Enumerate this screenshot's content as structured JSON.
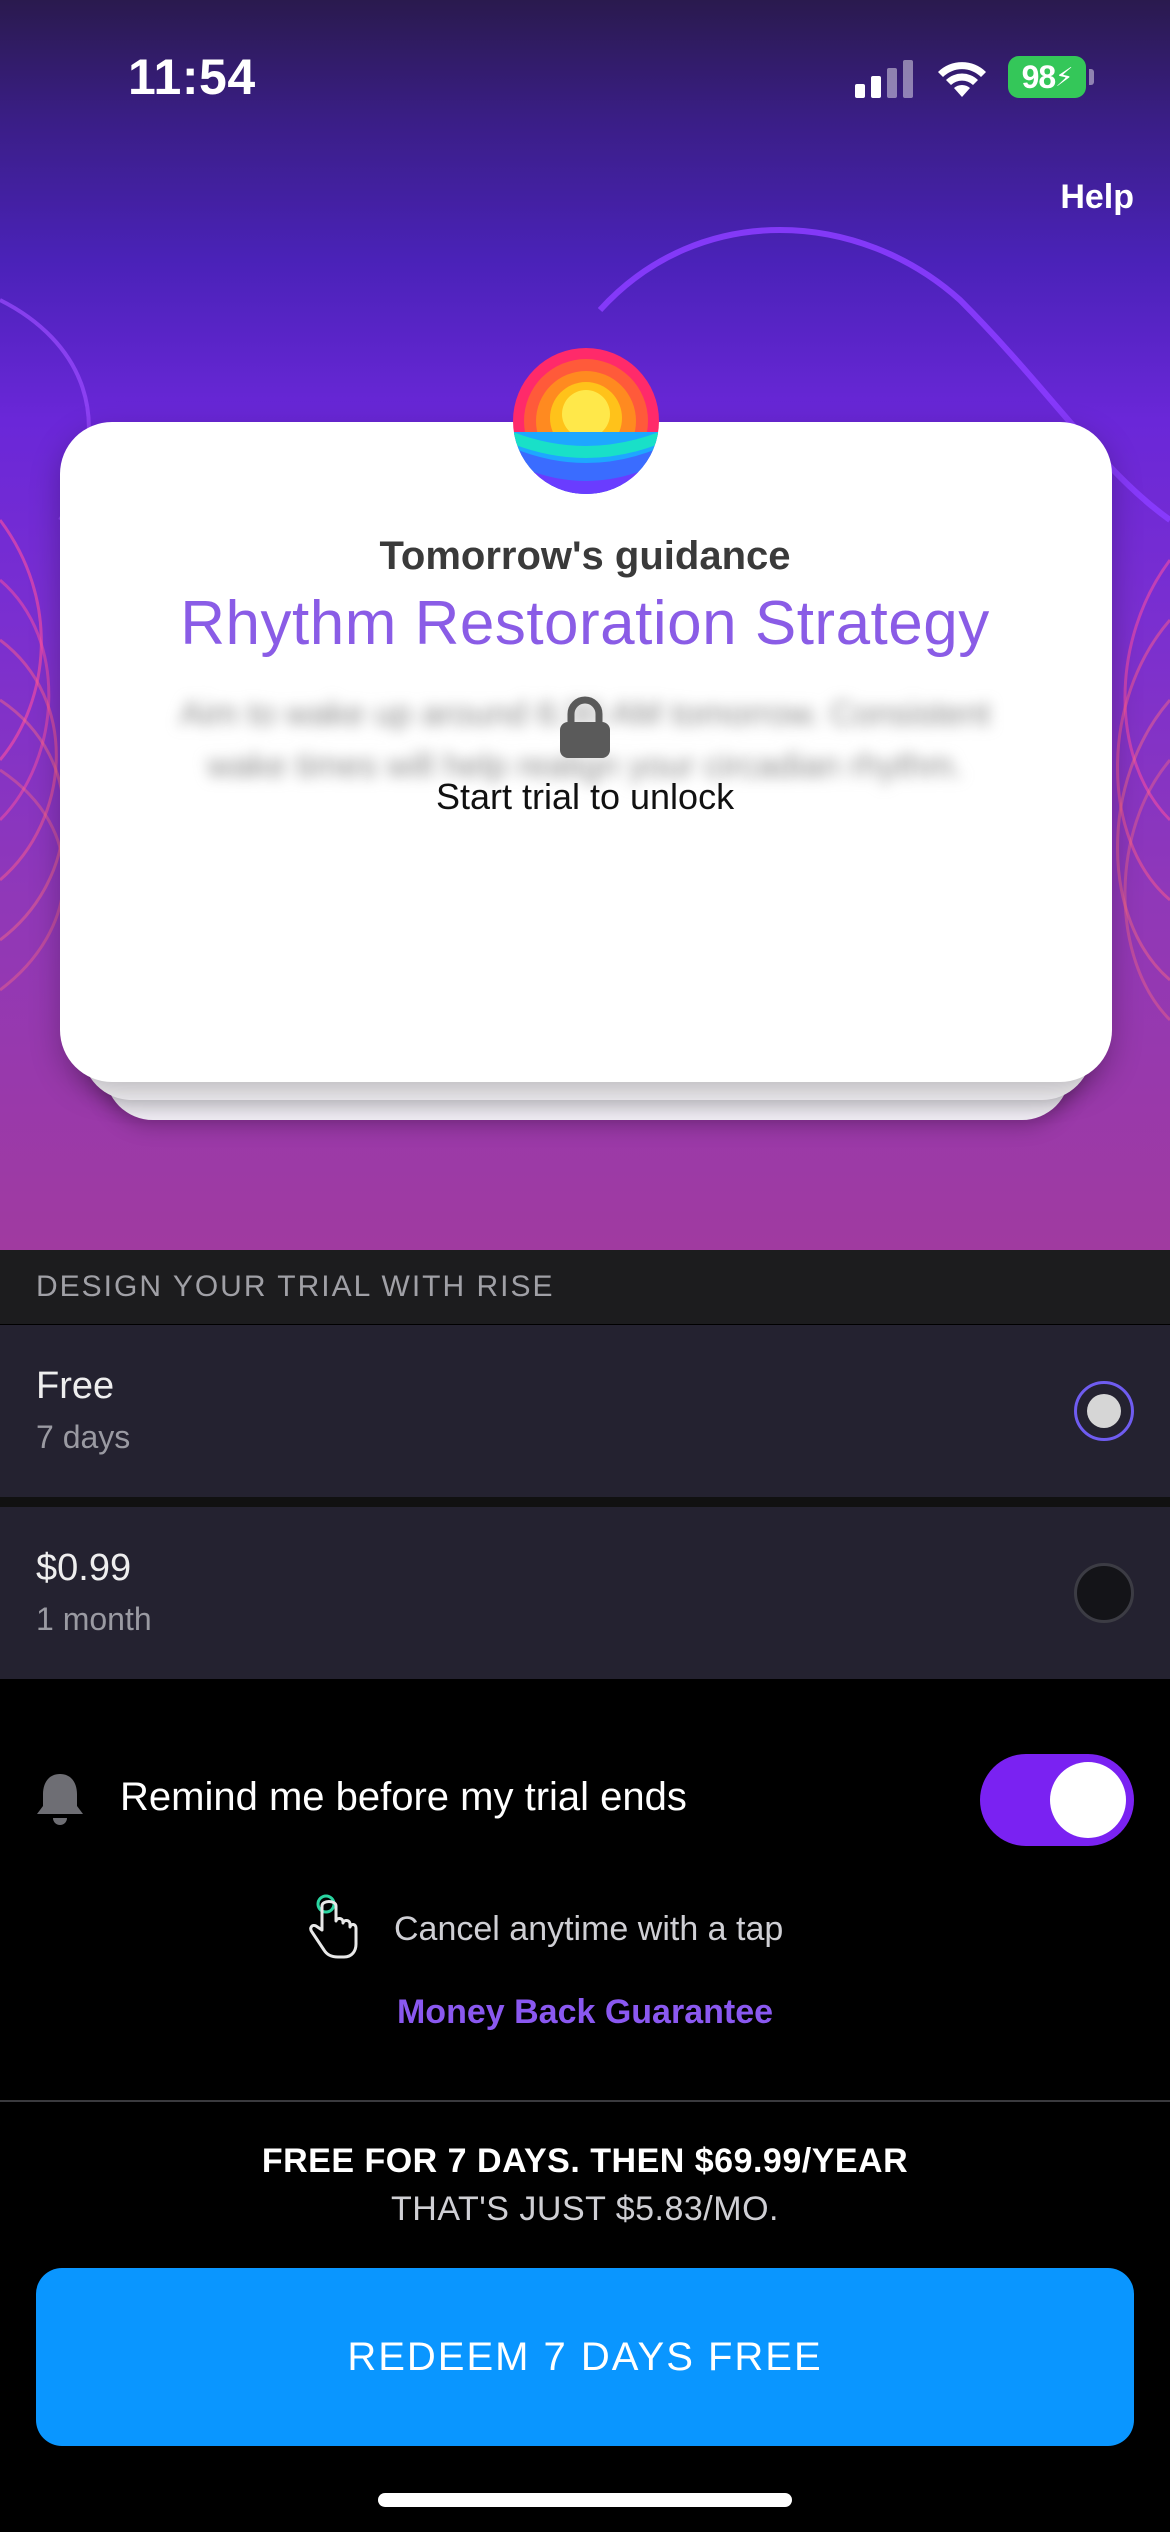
{
  "status_bar": {
    "time": "11:54",
    "battery": "98",
    "icons": [
      "signal-icon",
      "wifi-icon",
      "battery-icon"
    ]
  },
  "header": {
    "help_label": "Help"
  },
  "card": {
    "subtitle": "Tomorrow's guidance",
    "title": "Rhythm Restoration Strategy",
    "blurred_text": "Aim to wake up around 6:30 AM tomorrow. Consistent wake times will help realign your circadian rhythm.",
    "unlock_label": "Start trial to unlock"
  },
  "trial": {
    "section_header": "DESIGN YOUR TRIAL WITH RISE",
    "options": [
      {
        "title": "Free",
        "subtitle": "7 days",
        "selected": true
      },
      {
        "title": "$0.99",
        "subtitle": "1 month",
        "selected": false
      }
    ]
  },
  "reminder": {
    "label": "Remind me before my trial ends",
    "enabled": true
  },
  "cancel_text": "Cancel anytime with a tap",
  "money_back": "Money Back Guarantee",
  "pricing": {
    "line1": "FREE FOR 7 DAYS. THEN $69.99/YEAR",
    "line2": "THAT'S JUST $5.83/MO."
  },
  "cta": {
    "label": "REDEEM 7 DAYS FREE"
  },
  "colors": {
    "accent_purple": "#8a5ce6",
    "toggle_purple": "#7a22f2",
    "cta_blue": "#0a96ff",
    "battery_green": "#34c759"
  }
}
